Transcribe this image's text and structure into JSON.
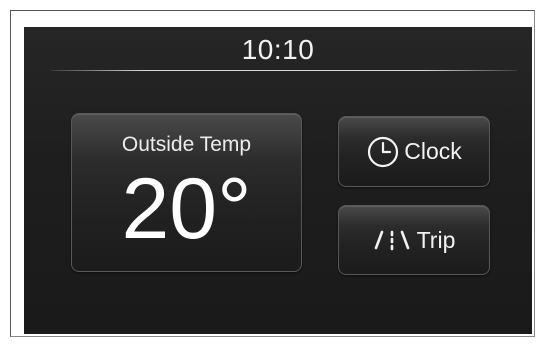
{
  "header": {
    "time": "10:10"
  },
  "outside_temp": {
    "label": "Outside Temp",
    "value": "20°"
  },
  "buttons": {
    "clock_label": "Clock",
    "clock_icon": "clock-icon",
    "trip_label": "Trip",
    "trip_icon": "road-icon"
  },
  "colors": {
    "screen_bg": "#1e1e1e",
    "text": "#f2f2f2",
    "button_border": "#585858"
  }
}
